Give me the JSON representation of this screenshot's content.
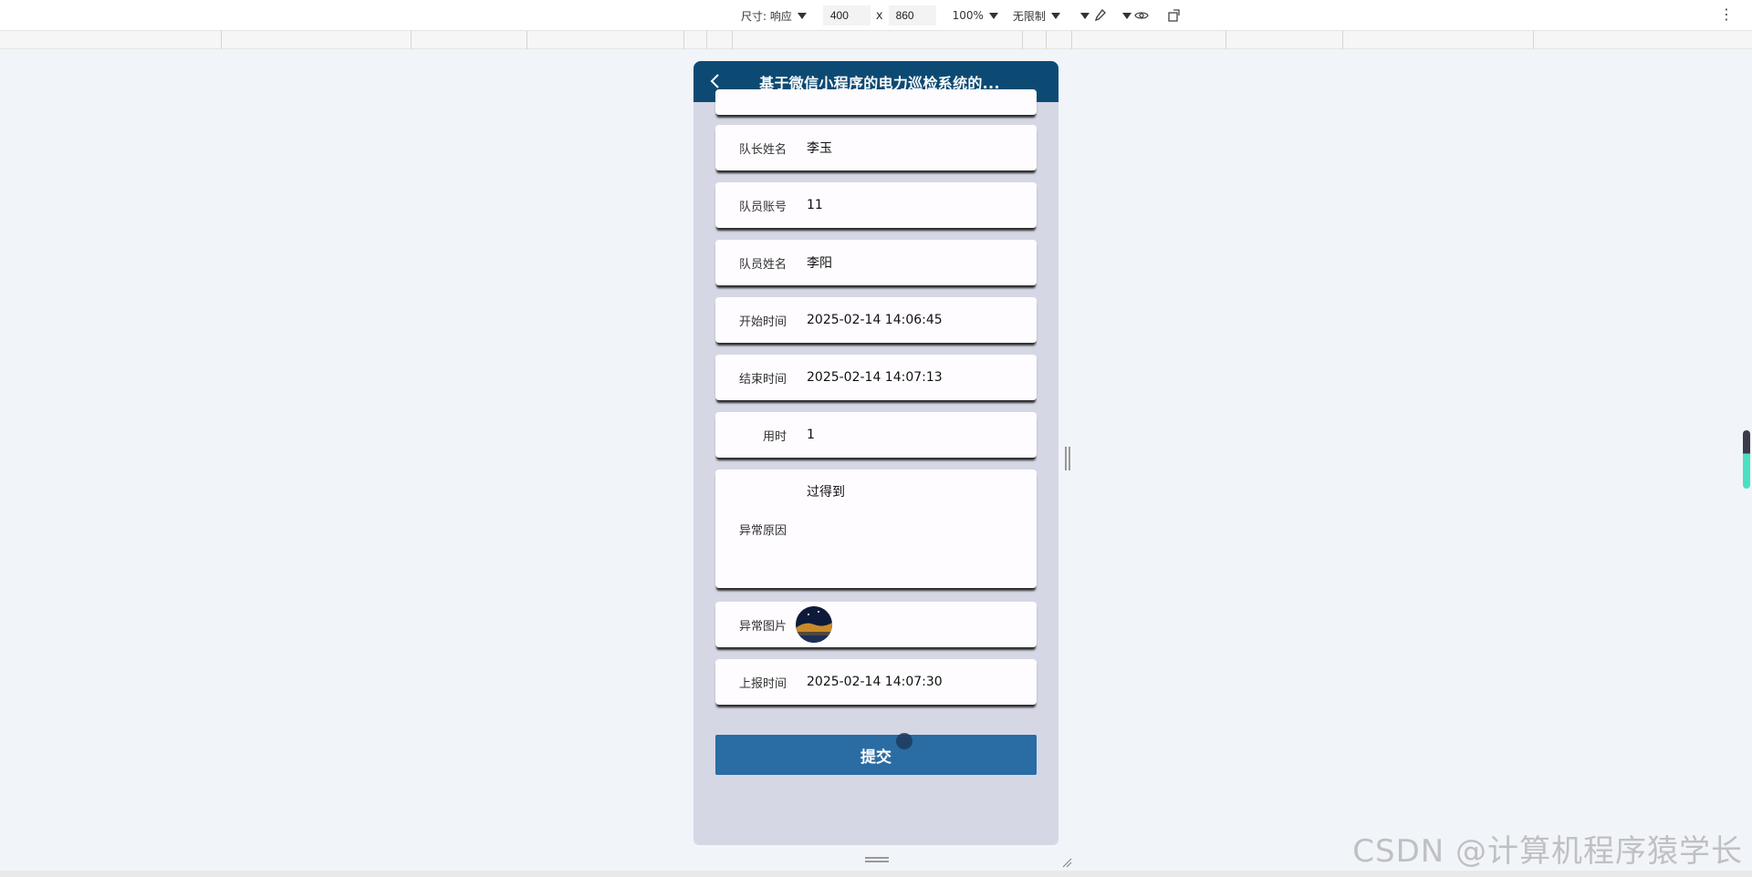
{
  "devtools": {
    "size_label": "尺寸: 响应",
    "width": "400",
    "height": "860",
    "x_sep": "x",
    "zoom": "100%",
    "throttle": "无限制"
  },
  "app": {
    "title": "基于微信小程序的电力巡检系统的..."
  },
  "fields": [
    {
      "label": "队长姓名",
      "value": "李玉"
    },
    {
      "label": "队员账号",
      "value": "11"
    },
    {
      "label": "队员姓名",
      "value": "李阳"
    },
    {
      "label": "开始时间",
      "value": "2025-02-14 14:06:45"
    },
    {
      "label": "结束时间",
      "value": "2025-02-14 14:07:13"
    },
    {
      "label": "用时",
      "value": "1"
    },
    {
      "label": "异常原因",
      "value": "过得到"
    },
    {
      "label": "异常图片",
      "value": ""
    },
    {
      "label": "上报时间",
      "value": "2025-02-14 14:07:30"
    }
  ],
  "submit_label": "提交",
  "watermark": "CSDN @计算机程序猿学长"
}
